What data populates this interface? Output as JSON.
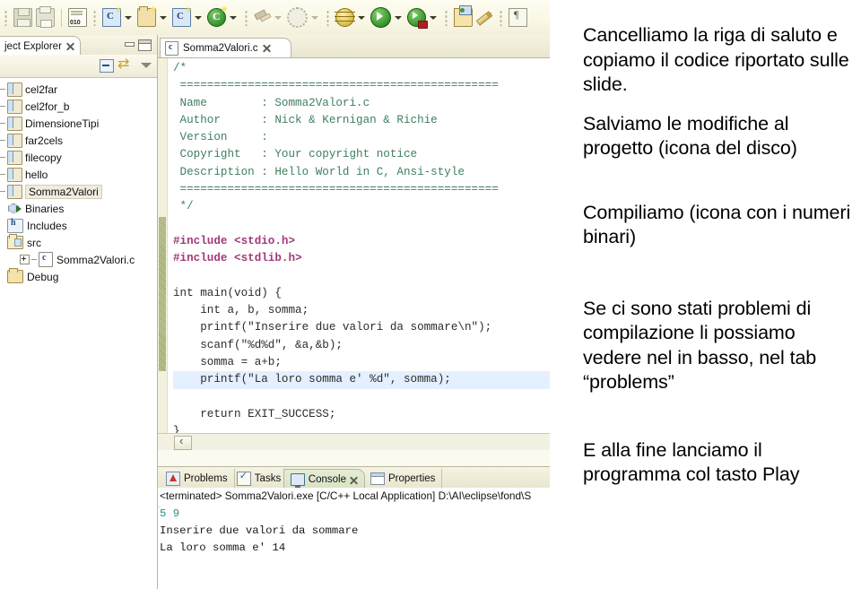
{
  "toolbar": {
    "items": [
      {
        "name": "save-icon",
        "label": "Save"
      },
      {
        "name": "print-icon",
        "label": "Print"
      },
      {
        "name": "build-binary-icon",
        "label": "Build (010)"
      },
      {
        "name": "new-c-project-icon",
        "label": "New C/C++ Project"
      },
      {
        "name": "new-folder-icon",
        "label": "New Folder"
      },
      {
        "name": "new-c-source-file-icon",
        "label": "New C Source File"
      },
      {
        "name": "new-c-class-icon",
        "label": "New Class"
      },
      {
        "name": "build-hammer-icon",
        "label": "Build"
      },
      {
        "name": "settings-gear-icon",
        "label": "Manage Configurations"
      },
      {
        "name": "debug-icon",
        "label": "Debug"
      },
      {
        "name": "run-icon",
        "label": "Run"
      },
      {
        "name": "run-external-icon",
        "label": "External Tools"
      },
      {
        "name": "open-resource-icon",
        "label": "Open Resource"
      },
      {
        "name": "annotation-pen-icon",
        "label": "Annotation"
      },
      {
        "name": "pilcrow-icon",
        "label": "Show Whitespace"
      }
    ]
  },
  "explorer": {
    "tab_title": "ject Explorer",
    "toolbar": {
      "collapse_all": "Collapse All",
      "link_with_editor": "Link with Editor",
      "view_menu": "View Menu"
    },
    "window_controls": {
      "minimize": "Minimize",
      "maximize": "Maximize"
    },
    "tree": [
      {
        "label": "cel2far",
        "icon": "project-icon",
        "depth": 0,
        "selected": false,
        "toggle": "stub"
      },
      {
        "label": "cel2for_b",
        "icon": "project-icon",
        "depth": 0,
        "selected": false,
        "toggle": "stub"
      },
      {
        "label": "DimensioneTipi",
        "icon": "project-icon",
        "depth": 0,
        "selected": false,
        "toggle": "stub"
      },
      {
        "label": "far2cels",
        "icon": "project-icon",
        "depth": 0,
        "selected": false,
        "toggle": "stub"
      },
      {
        "label": "filecopy",
        "icon": "project-icon",
        "depth": 0,
        "selected": false,
        "toggle": "stub"
      },
      {
        "label": "hello",
        "icon": "project-icon",
        "depth": 0,
        "selected": false,
        "toggle": "stub"
      },
      {
        "label": "Somma2Valori",
        "icon": "project-icon",
        "depth": 0,
        "selected": true,
        "toggle": "stub"
      },
      {
        "label": "Binaries",
        "icon": "binaries-icon",
        "depth": 1,
        "selected": false,
        "toggle": "none"
      },
      {
        "label": "Includes",
        "icon": "includes-icon",
        "depth": 1,
        "selected": false,
        "toggle": "none"
      },
      {
        "label": "src",
        "icon": "source-folder-icon",
        "depth": 1,
        "selected": false,
        "toggle": "none"
      },
      {
        "label": "Somma2Valori.c",
        "icon": "c-file-icon",
        "depth": 2,
        "selected": false,
        "toggle": "plus"
      },
      {
        "label": "Debug",
        "icon": "folder-icon",
        "depth": 1,
        "selected": false,
        "toggle": "none"
      }
    ]
  },
  "editor": {
    "tab_label": "Somma2Valori.c",
    "code_lines": [
      {
        "text": "/*",
        "cls": "cmt"
      },
      {
        "text": " ===============================================",
        "cls": "cmt"
      },
      {
        "text": " Name        : Somma2Valori.c",
        "cls": "cmt"
      },
      {
        "text": " Author      : Nick & Kernigan & Richie",
        "cls": "cmt"
      },
      {
        "text": " Version     :",
        "cls": "cmt"
      },
      {
        "text": " Copyright   : Your copyright notice",
        "cls": "cmt"
      },
      {
        "text": " Description : Hello World in C, Ansi-style",
        "cls": "cmt"
      },
      {
        "text": " ===============================================",
        "cls": "cmt"
      },
      {
        "text": " */",
        "cls": "cmt"
      },
      {
        "text": "",
        "cls": "plain"
      },
      {
        "text": "#include <stdio.h>",
        "cls": "pre"
      },
      {
        "text": "#include <stdlib.h>",
        "cls": "pre"
      },
      {
        "text": "",
        "cls": "plain"
      },
      {
        "text": "int main(void) {",
        "cls": "plain"
      },
      {
        "text": "    int a, b, somma;",
        "cls": "plain"
      },
      {
        "text": "    printf(\"Inserire due valori da sommare\\n\");",
        "cls": "plain"
      },
      {
        "text": "    scanf(\"%d%d\", &a,&b);",
        "cls": "plain"
      },
      {
        "text": "    somma = a+b;",
        "cls": "plain"
      },
      {
        "text": "    printf(\"La loro somma e' %d\", somma);",
        "cls": "highlight"
      },
      {
        "text": "    return EXIT_SUCCESS;",
        "cls": "plain"
      },
      {
        "text": "}",
        "cls": "plain"
      }
    ]
  },
  "console": {
    "tabs": [
      {
        "label": "Problems",
        "icon": "problems-icon",
        "active": false
      },
      {
        "label": "Tasks",
        "icon": "tasks-icon",
        "active": false
      },
      {
        "label": "Console",
        "icon": "console-icon",
        "active": true
      },
      {
        "label": "Properties",
        "icon": "properties-icon",
        "active": false
      }
    ],
    "header": "<terminated> Somma2Valori.exe [C/C++ Local Application] D:\\AI\\eclipse\\fond\\S",
    "lines": [
      {
        "text": "5 9",
        "cls": "input"
      },
      {
        "text": "Inserire due valori da sommare",
        "cls": "out"
      },
      {
        "text": "La loro somma e' 14",
        "cls": "out"
      }
    ]
  },
  "notes": {
    "p1": "Cancelliamo la riga di saluto e copiamo il codice riportato sulle slide.",
    "p2": "Salviamo le modifiche al progetto (icona del disco)",
    "p3": "Compiliamo (icona con i numeri binari)",
    "p4": "Se ci sono stati problemi di compilazione li possiamo vedere nel in basso, nel tab “problems”",
    "p5": "E alla fine lanciamo il programma col tasto Play"
  },
  "colors": {
    "toolbar_bg": "#faf8e6",
    "tree_selected": "#f1ece0",
    "code_highlight": "#e4efff",
    "console_tab_active": "#d7e3c2",
    "comment_green": "#3f7f5f",
    "preproc_magenta": "#a03a7a"
  }
}
